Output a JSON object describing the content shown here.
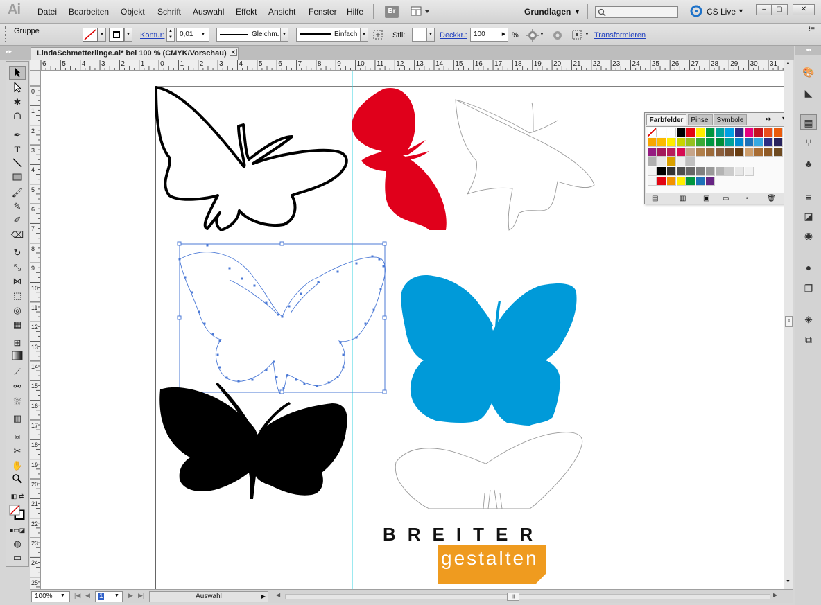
{
  "app": {
    "logo": "Ai",
    "menu": [
      "Datei",
      "Bearbeiten",
      "Objekt",
      "Schrift",
      "Auswahl",
      "Effekt",
      "Ansicht",
      "Fenster",
      "Hilfe"
    ],
    "bridge_label": "Br",
    "workspace": "Grundlagen",
    "search_placeholder": "",
    "cs_live": "CS Live",
    "window_min": "–",
    "window_max": "▢",
    "window_close": "✕"
  },
  "control": {
    "selection_type": "Gruppe",
    "stroke_label": "Kontur:",
    "stroke_weight": "0,01",
    "profile_label": "Gleichm.",
    "brush_label": "Einfach",
    "style_label": "Stil:",
    "opacity_label": "Deckkr.:",
    "opacity_value": "100",
    "percent": "%",
    "transform_link": "Transformieren"
  },
  "document": {
    "tab_title": "LindaSchmetterlinge.ai* bei 100 % (CMYK/Vorschau)",
    "tab_close": "✕"
  },
  "rulers": {
    "top": [
      "6",
      "5",
      "4",
      "3",
      "2",
      "1",
      "0",
      "1",
      "2",
      "3",
      "4",
      "5",
      "6",
      "7",
      "8",
      "9",
      "10",
      "11",
      "12",
      "13",
      "14",
      "15",
      "16",
      "17",
      "18",
      "19",
      "20",
      "21",
      "22",
      "23",
      "24",
      "25",
      "26",
      "27",
      "28",
      "29",
      "30",
      "31"
    ],
    "left": [
      "0",
      "1",
      "2",
      "3",
      "4",
      "5",
      "6",
      "7",
      "8",
      "9",
      "10",
      "11",
      "12",
      "13",
      "14",
      "15",
      "16",
      "17",
      "18",
      "19",
      "20",
      "21",
      "22",
      "23",
      "24",
      "25"
    ]
  },
  "swatches": {
    "tabs": [
      "Farbfelder",
      "Pinsel",
      "Symbole"
    ],
    "row1": [
      "#ffffff",
      "#ffffff",
      "#ffffff",
      "#000000",
      "#e30613",
      "#ffed00",
      "#009640",
      "#00a19a",
      "#009fe3",
      "#312783",
      "#e6007e",
      "#c5121f",
      "#e94e1b",
      "#ea5b0c",
      "#f39200"
    ],
    "row2": [
      "#f7a600",
      "#fbba00",
      "#ffed00",
      "#c8d400",
      "#95c11f",
      "#3aaa35",
      "#009640",
      "#008d36",
      "#00a19a",
      "#008bd2",
      "#1d71b8",
      "#36a9e1",
      "#2d2e83",
      "#29235c",
      "#662483"
    ],
    "row3": [
      "#951b81",
      "#a3195b",
      "#b61d5b",
      "#d60b52",
      "#c6a58a",
      "#b17f4a",
      "#9d6b3b",
      "#8b5e3c",
      "#7b4f2c",
      "#683c11",
      "#cd9d6b",
      "#a86c32",
      "#8f5a26",
      "#6e4a21",
      "#5a3a1a"
    ],
    "grays": [
      "#000000",
      "#333333",
      "#4d4d4d",
      "#666666",
      "#808080",
      "#999999",
      "#b3b3b3",
      "#cccccc",
      "#e6e6e6",
      "#f2f2f2"
    ],
    "group": [
      "#e30613",
      "#f39200",
      "#ffed00",
      "#009640",
      "#1d71b8",
      "#662483"
    ]
  },
  "canvas_objects": {
    "brand_top": "BREITER",
    "brand_bottom": "gestalten"
  },
  "status": {
    "zoom": "100%",
    "page": "1",
    "tool_name": "Auswahl"
  },
  "colors": {
    "red_butterfly": "#e0001b",
    "blue_butterfly": "#009ad9",
    "selection": "#4b79d6",
    "brand_orange": "#ef9b1f"
  }
}
